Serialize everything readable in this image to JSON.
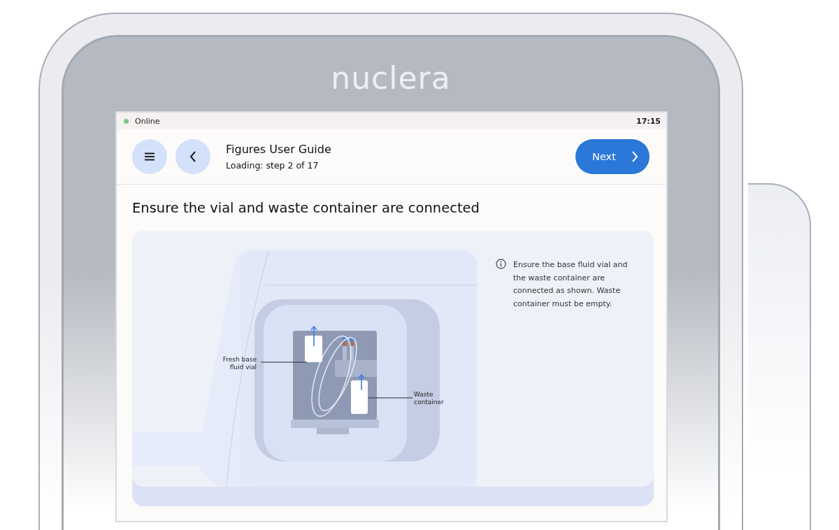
{
  "device": {
    "brand": "nuclera"
  },
  "status_bar": {
    "connection": "Online",
    "online": true,
    "time": "17:15"
  },
  "header": {
    "title": "Figures User Guide",
    "subtitle": "Loading: step 2 of 17",
    "next_button": "Next"
  },
  "heading": "Ensure the vial and waste container are connected",
  "figure": {
    "callouts": [
      {
        "kind": "left",
        "lines": [
          "Fresh base",
          "fluid vial"
        ]
      },
      {
        "kind": "right",
        "lines": [
          "Waste",
          "container"
        ]
      }
    ],
    "info": "Ensure the base fluid vial and the waste container are connected as shown. Waste container must be empty."
  }
}
